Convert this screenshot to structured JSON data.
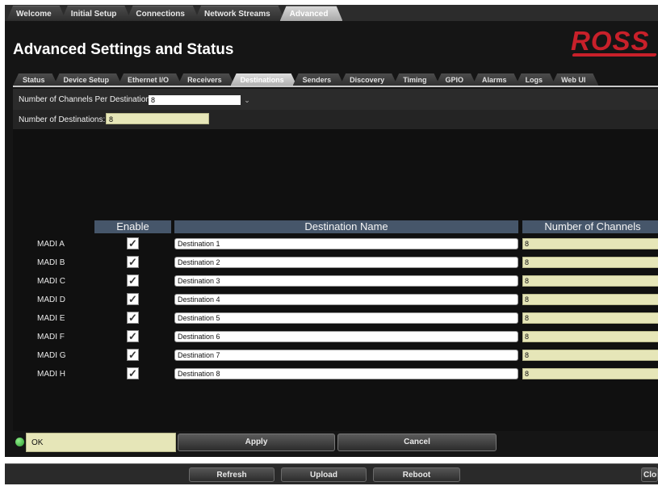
{
  "top_tabs": [
    {
      "label": "Welcome"
    },
    {
      "label": "Initial Setup"
    },
    {
      "label": "Connections"
    },
    {
      "label": "Network Streams"
    },
    {
      "label": "Advanced",
      "active": true
    }
  ],
  "page": {
    "title": "Advanced Settings and Status",
    "logo_text": "ROSS"
  },
  "sub_tabs": [
    {
      "label": "Status"
    },
    {
      "label": "Device Setup"
    },
    {
      "label": "Ethernet I/O"
    },
    {
      "label": "Receivers"
    },
    {
      "label": "Destinations",
      "active": true
    },
    {
      "label": "Senders"
    },
    {
      "label": "Discovery"
    },
    {
      "label": "Timing"
    },
    {
      "label": "GPIO"
    },
    {
      "label": "Alarms"
    },
    {
      "label": "Logs"
    },
    {
      "label": "Web UI"
    }
  ],
  "settings": {
    "channels_per_dest_label": "Number of Channels Per Destination",
    "channels_per_dest_value": "8",
    "num_destinations_label": "Number of Destinations:",
    "num_destinations_value": "8"
  },
  "table": {
    "headers": {
      "enable": "Enable",
      "name": "Destination Name",
      "channels": "Number of Channels"
    },
    "rows": [
      {
        "label": "MADI A",
        "enabled": true,
        "name": "Destination 1",
        "channels": "8"
      },
      {
        "label": "MADI B",
        "enabled": true,
        "name": "Destination 2",
        "channels": "8"
      },
      {
        "label": "MADI C",
        "enabled": true,
        "name": "Destination 3",
        "channels": "8"
      },
      {
        "label": "MADI D",
        "enabled": true,
        "name": "Destination 4",
        "channels": "8"
      },
      {
        "label": "MADI E",
        "enabled": true,
        "name": "Destination 5",
        "channels": "8"
      },
      {
        "label": "MADI F",
        "enabled": true,
        "name": "Destination 6",
        "channels": "8"
      },
      {
        "label": "MADI G",
        "enabled": true,
        "name": "Destination 7",
        "channels": "8"
      },
      {
        "label": "MADI H",
        "enabled": true,
        "name": "Destination 8",
        "channels": "8"
      }
    ]
  },
  "status": {
    "text": "OK",
    "led_color": "#3cc23a"
  },
  "actions": {
    "apply": "Apply",
    "cancel": "Cancel"
  },
  "footer": {
    "refresh": "Refresh",
    "upload": "Upload",
    "reboot": "Reboot",
    "close": "Close"
  },
  "icons": {
    "dropdown": "chevron-down-icon",
    "checkbox": "checkmark-icon",
    "status": "status-led-icon"
  },
  "colors": {
    "brand": "#c8202a",
    "header_bg": "#46566a",
    "field_yellow": "#e6e6b8"
  }
}
